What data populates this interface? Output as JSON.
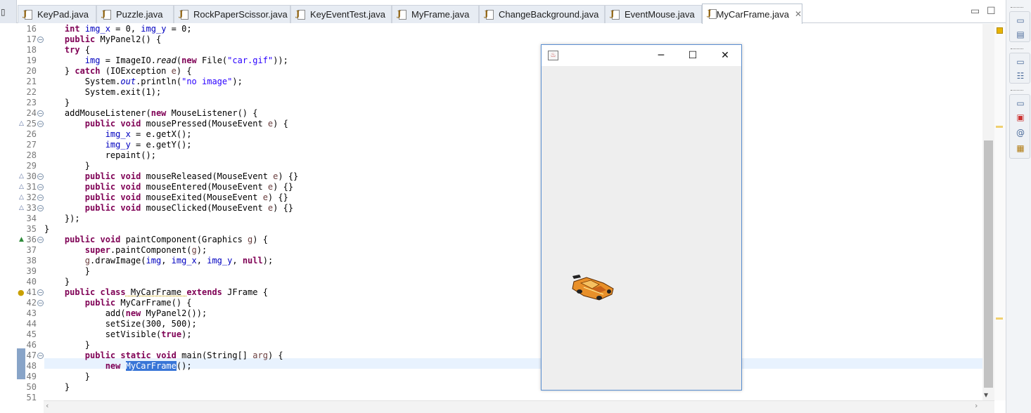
{
  "tabs": [
    {
      "label": "KeyPad.java",
      "active": false
    },
    {
      "label": "Puzzle.java",
      "active": false
    },
    {
      "label": "RockPaperScissor.java",
      "active": false
    },
    {
      "label": "KeyEventTest.java",
      "active": false
    },
    {
      "label": "MyFrame.java",
      "active": false
    },
    {
      "label": "ChangeBackground.java",
      "active": false
    },
    {
      "label": "EventMouse.java",
      "active": false
    },
    {
      "label": "MyCarFrame.java",
      "active": true
    }
  ],
  "tab_close_symbol": "✕",
  "editor_controls": {
    "minimize": "▭",
    "maximize": "☐"
  },
  "line_numbers": [
    "16",
    "17",
    "18",
    "19",
    "20",
    "21",
    "22",
    "23",
    "24",
    "25",
    "26",
    "27",
    "28",
    "29",
    "30",
    "31",
    "32",
    "33",
    "34",
    "35",
    "36",
    "37",
    "38",
    "39",
    "40",
    "41",
    "42",
    "43",
    "44",
    "45",
    "46",
    "47",
    "48",
    "49",
    "50",
    "51"
  ],
  "code": {
    "img_decl_a": "int",
    "img_decl_b": " img_x",
    "img_decl_c": " = 0,",
    "img_decl_d": " img_y",
    "img_decl_e": " = 0;",
    "public": "public",
    "mypanel2_ctor": " MyPanel2() {",
    "try": "try",
    "try_brace": " {",
    "img_read_a": "img",
    "img_read_b": " = ImageIO.",
    "img_read_c": "read",
    "img_read_d": "(",
    "new": "new",
    "img_read_e": " File(",
    "car_gif": "\"car.gif\"",
    "img_read_f": "));",
    "catch_open": "} ",
    "catch": "catch",
    "catch_rest_a": " (IOException ",
    "e": "e",
    "catch_rest_b": ") {",
    "sysout_a": "System.",
    "out": "out",
    "sysout_b": ".println(",
    "no_image": "\"no image\"",
    "sysout_c": ");",
    "exit": "System.exit(1);",
    "close_brace": "}",
    "add_ml_a": "addMouseListener(",
    "add_ml_b": " MouseListener() {",
    "void": "void",
    "mouse_pressed": " mousePressed(MouseEvent ",
    "brace_open": ") {",
    "img_x": "img_x",
    "img_y": "img_y",
    "getx": " = e.getX();",
    "gety": " = e.getY();",
    "repaint": "repaint();",
    "mouse_released": " mouseReleased(MouseEvent ",
    "mouse_entered": " mouseEntered(MouseEvent ",
    "mouse_exited": " mouseExited(MouseEvent ",
    "mouse_clicked": " mouseClicked(MouseEvent ",
    "empty_body": ") {}",
    "close_paren": "});",
    "paint_component": " paintComponent(Graphics ",
    "g": "g",
    "super": "super",
    "super_paint": ".paintComponent(",
    "super_paint_end": ");",
    "draw_a": ".drawImage(",
    "img": "img",
    "comma": ", ",
    "null": "null",
    "draw_end": ");",
    "class": "class",
    "mycarframe_class": " MyCarFrame ",
    "extends": "extends",
    "jframe": " JFrame {",
    "mycarframe_ctor": " MyCarFrame() {",
    "add_panel_a": "add(",
    "add_panel_b": " MyPanel2());",
    "set_size": "setSize(300, 500);",
    "set_visible_a": "setVisible(",
    "true": "true",
    "set_visible_b": ");",
    "static": "static",
    "main_sig": " main(String[] ",
    "arg": "arg",
    "mycarframe_sel": "MyCarFrame",
    "new_end": "();"
  },
  "jframe": {
    "minimize_glyph": "─",
    "maximize_glyph": "☐",
    "close_glyph": "✕",
    "java_icon": "♨"
  },
  "hscroll": {
    "left_arrow": "‹",
    "right_arrow": "›"
  },
  "vscroll": {
    "down_arrow": "▾"
  }
}
